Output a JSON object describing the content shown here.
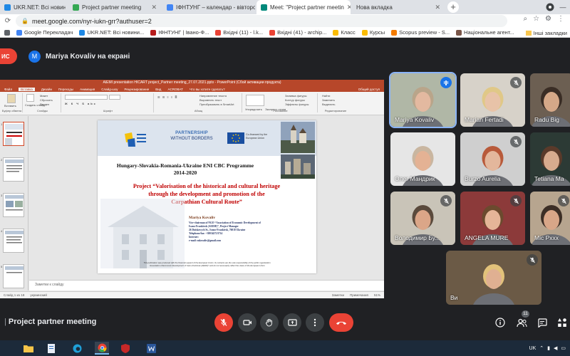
{
  "browser": {
    "tabs": [
      {
        "label": "UKR.NET: Всі новини України, о",
        "color": "#1e88e5"
      },
      {
        "label": "Project partner meeting",
        "color": "#34a853"
      },
      {
        "label": "ІФНТУНГ – календар - вівторо",
        "color": "#4285f4"
      },
      {
        "label": "Meet: \"Project partner meetin",
        "color": "#00897b"
      },
      {
        "label": "Нова вкладка",
        "color": "#9e9e9e"
      }
    ],
    "active_tab": 3,
    "url": "meet.google.com/nyr-iukn-grr?authuser=2",
    "bookmarks": [
      {
        "label": "Додатки",
        "color": "#5f6368"
      },
      {
        "label": "Google Перекладач",
        "color": "#4285f4"
      },
      {
        "label": "UKR.NET: Всі новини...",
        "color": "#1e88e5"
      },
      {
        "label": "ІФНТУНГ | Івано-Ф...",
        "color": "#b71c1c"
      },
      {
        "label": "Вхідні (11) - l.k...",
        "color": "#ea4335"
      },
      {
        "label": "Вхідні (41) - archip...",
        "color": "#ea4335"
      },
      {
        "label": "Класс",
        "color": "#fbbc04"
      },
      {
        "label": "Курсы",
        "color": "#fbbc04"
      },
      {
        "label": "Scopus preview - S...",
        "color": "#f57c00"
      },
      {
        "label": "Національне агент...",
        "color": "#795548"
      }
    ],
    "other_bookmarks": "Інші закладки"
  },
  "meet": {
    "presenting_label": "ИС",
    "presenter_initial": "M",
    "presenter_text": "Mariya Kovaliv на екрані",
    "meeting_name": "Project partner meeting",
    "participant_count": "11",
    "colors": {
      "hangup": "#ea4335",
      "mic_off": "#ea4335",
      "accent": "#1a73e8"
    },
    "participants": [
      {
        "name": "Mariya Kovaliv",
        "speaking": true,
        "muted": false,
        "bg": "#b0b7a6",
        "skin": "#e3b9a0",
        "hair": "#b9a58a"
      },
      {
        "name": "Marian Fertadi",
        "speaking": false,
        "muted": true,
        "bg": "#d7d2c9",
        "skin": "#e8c3a8",
        "hair": "#e0c887"
      },
      {
        "name": "Radu Big",
        "speaking": false,
        "muted": false,
        "bg": "#6c5f52",
        "skin": "#d5a888",
        "hair": "#3a2d25"
      },
      {
        "name": "Олег Мандрик",
        "speaking": false,
        "muted": false,
        "bg": "#e6e6e6",
        "skin": "#e4b294",
        "hair": "#c9b6a0"
      },
      {
        "name": "Burzo Aurelia",
        "speaking": false,
        "muted": true,
        "bg": "#cfcfcf",
        "skin": "#e3b79c",
        "hair": "#b85a3a"
      },
      {
        "name": "Tetiana Ma",
        "speaking": false,
        "muted": false,
        "bg": "#2c3a35",
        "skin": "#d8ab8e",
        "hair": "#5a3a2a"
      },
      {
        "name": "Володимир Бу...",
        "speaking": false,
        "muted": true,
        "bg": "#c9c4b8",
        "skin": "#dba688",
        "hair": "#5a4a3c"
      },
      {
        "name": "ANGELA MURE",
        "speaking": false,
        "muted": true,
        "bg": "#8c3a3a",
        "skin": "#e5b598",
        "hair": "#6b4a2e"
      },
      {
        "name": "Mic Pxxx",
        "speaking": false,
        "muted": true,
        "bg": "#b7a58f",
        "skin": "#d8a688",
        "hair": "#3c2e26"
      },
      {
        "name": "Ви",
        "speaking": false,
        "muted": true,
        "bg": "#6b5a46",
        "skin": "#e0b092",
        "hair": "#e2c27a"
      }
    ]
  },
  "powerpoint": {
    "title": "AIEMI presentation HICART project_Partner meeting_27.07.2021.pptx - PowerPoint (Сбой активации продукта)",
    "tabs": [
      "Файл",
      "Вставка",
      "Дизайн",
      "Переходы",
      "Анимация",
      "Слайд-шоу",
      "Рецензирование",
      "Вид",
      "ACROBAT",
      "Что вы хотите сделать?"
    ],
    "share_label": "Общий доступ",
    "ribbon_groups": [
      "Буфер обмена",
      "Слайды",
      "Шрифт",
      "Абзац",
      "Рисование",
      "Редактирование"
    ],
    "ribbon_items": {
      "paste": "Вставить",
      "create_slide": "Создать слайд",
      "layout": "Макет",
      "reset": "Сбросить",
      "section": "Раздел",
      "text_direction": "Направление текста",
      "align_text": "Выровнять текст",
      "smartart": "Преобразовать в SmartArt",
      "arrange": "Упорядочить",
      "quick_styles": "Экспресс-стили",
      "shape_fill": "Заливка фигуры",
      "shape_outline": "Контур фигуры",
      "shape_effects": "Эффекты фигуры",
      "find": "Найти",
      "replace": "Заменить",
      "select": "Выделить"
    },
    "notes_placeholder": "Заметки к слайду",
    "status_left": "Слайд 1 из 18",
    "status_lang": "украинский",
    "status_notes": "Заметки",
    "status_comments": "Примечания",
    "status_zoom": "51%",
    "slide_numbers": [
      "1",
      "2",
      "3",
      "4",
      "5"
    ],
    "slide": {
      "partner_line1": "PARTNERSHIP",
      "partner_line2": "WITHOUT BORDERS",
      "eu_text1": "Co-financed by the",
      "eu_text2": "European Union",
      "programme_line1": "Hungary-Slovakia-Romania-Ukraine ENI CBC Programme",
      "programme_line2": "2014-2020",
      "project_line1": "Project “Valorisation of the historical and cultural heritage",
      "project_line2": "through the development and promotion of the",
      "project_line3": "Carpathian Cultural Route”",
      "contact_name": "Mariya Kovaliv",
      "contact_role1": "Vice-chairman of NGO “Association of Economic Development of",
      "contact_role2": "Ivano-Frankivsk (AEDIF)”, Project Manager",
      "contact_address": "26 Dniskovych St., Ivano-Frankivsk, 76018 Ukraine",
      "contact_phone": "Telephone/fax: +380342723714",
      "contact_internet": "Internet:",
      "contact_email": "e-mail: mkovaliv@gmail.com",
      "footnote1": "This publication was produced with the financial support of the European Union. Its contents are the sole responsibility of the public organization",
      "footnote2": "“Association of Economic Development of Ivano-Frankivsk (AEDIF)” and do not necessarily reflect the views of the European Union"
    }
  },
  "taskbar": {
    "tray_lang": "UK"
  }
}
